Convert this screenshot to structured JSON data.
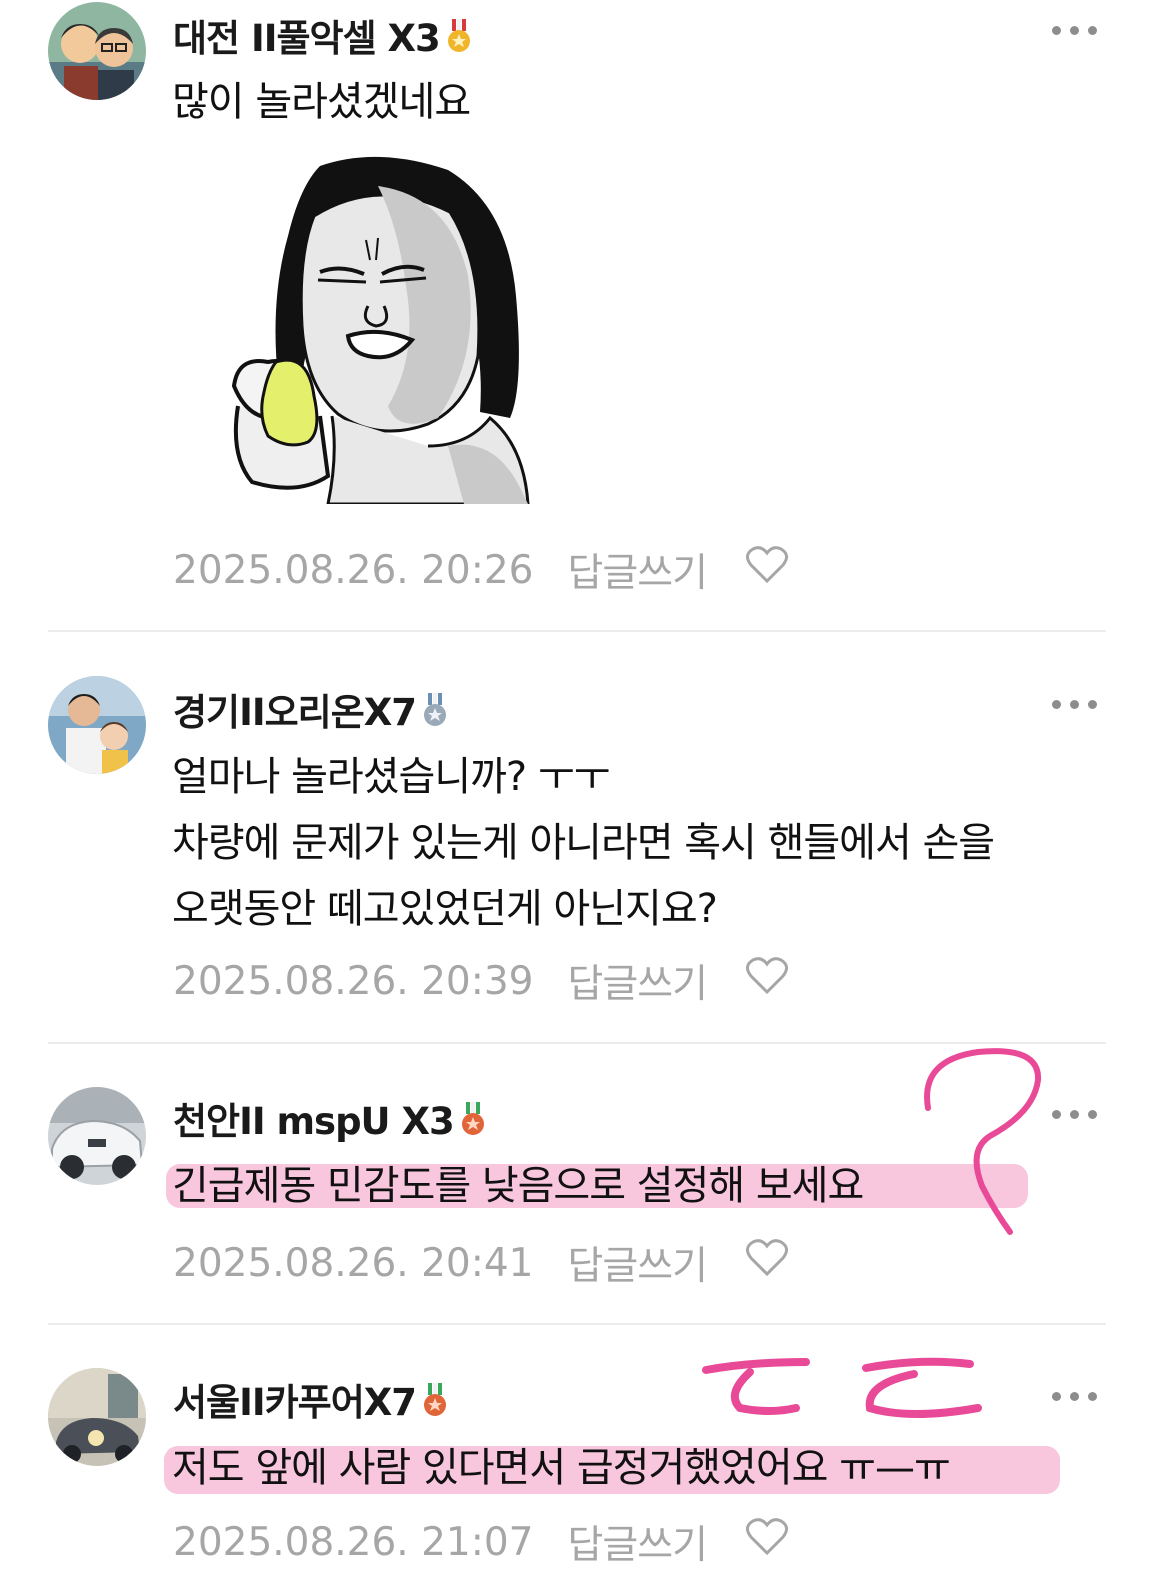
{
  "comments": [
    {
      "author": "대전 II풀악셀 X3",
      "text": "많이 놀라셨겠네요",
      "date": "2025.08.26. 20:26",
      "reply_label": "답글쓰기",
      "medal_color": "#f1b52c"
    },
    {
      "author": "경기II오리온X7",
      "text": "얼마나 놀라셨습니까? ㅜㅜ\n차량에 문제가 있는게 아니라면 혹시 핸들에서 손을\n오랫동안 떼고있었던게 아닌지요?",
      "date": "2025.08.26. 20:39",
      "reply_label": "답글쓰기",
      "medal_color": "#9aa9b8"
    },
    {
      "author": "천안II mspU X3",
      "text": "긴급제동 민감도를 낮음으로 설정해 보세요",
      "date": "2025.08.26. 20:41",
      "reply_label": "답글쓰기",
      "medal_color": "#e0663a"
    },
    {
      "author": "서울II카푸어X7",
      "text": "저도 앞에 사람 있다면서 급정거했었어요 ㅠ—ㅠ",
      "date": "2025.08.26. 21:07",
      "reply_label": "답글쓰기",
      "medal_color": "#e0663a"
    }
  ],
  "colors": {
    "annotation_pink": "#e94a97",
    "highlight_pink": "#f6b3d2",
    "meta_gray": "#a6a6a6"
  },
  "icons": [
    "more-icon",
    "heart-icon",
    "medal-icon",
    "sticker-crying-girl"
  ]
}
